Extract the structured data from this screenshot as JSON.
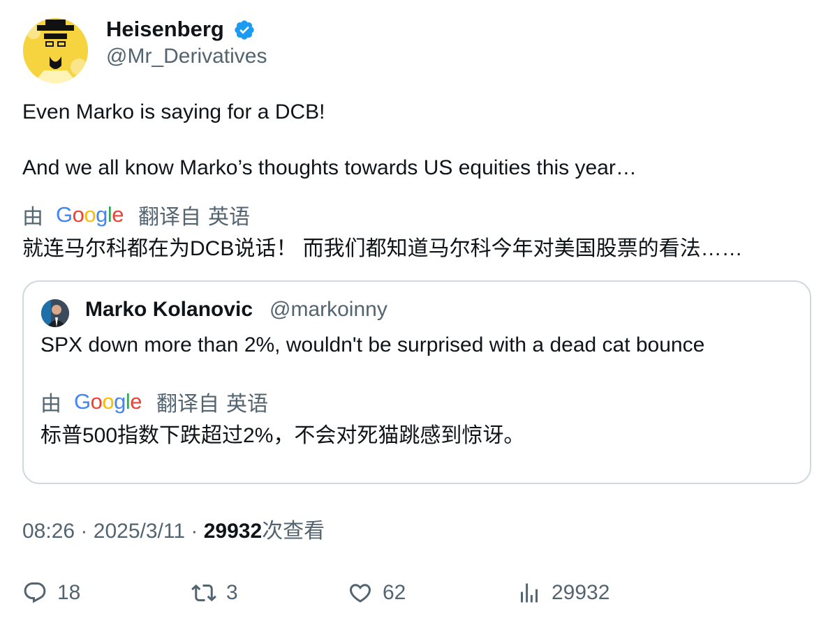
{
  "author": {
    "name": "Heisenberg",
    "handle": "@Mr_Derivatives",
    "verified_color": "#1d9bf0",
    "avatar_icon": "heisenberg-avatar"
  },
  "tweet": {
    "lines": [
      "Even Marko is saying for a DCB!",
      "And we all know Marko’s thoughts towards US equities this year…"
    ]
  },
  "translation": {
    "by": "由",
    "provider": "Google",
    "from_label": "翻译自",
    "language": "英语",
    "text": "就连马尔科都在为DCB说话！ 而我们都知道马尔科今年对美国股票的看法……"
  },
  "quote": {
    "name": "Marko Kolanovic",
    "handle": "@markoinny",
    "text": "SPX down more than 2%, wouldn't be surprised with a dead cat bounce",
    "translation": {
      "by": "由",
      "provider": "Google",
      "from_label": "翻译自",
      "language": "英语",
      "text": "标普500指数下跌超过2%，不会对死猫跳感到惊讶。"
    }
  },
  "meta": {
    "time": "08:26",
    "sep": "·",
    "date": "2025/3/11",
    "views_count": "29932",
    "views_label": "次查看"
  },
  "actions": {
    "replies": "18",
    "retweets": "3",
    "likes": "62",
    "views": "29932"
  }
}
